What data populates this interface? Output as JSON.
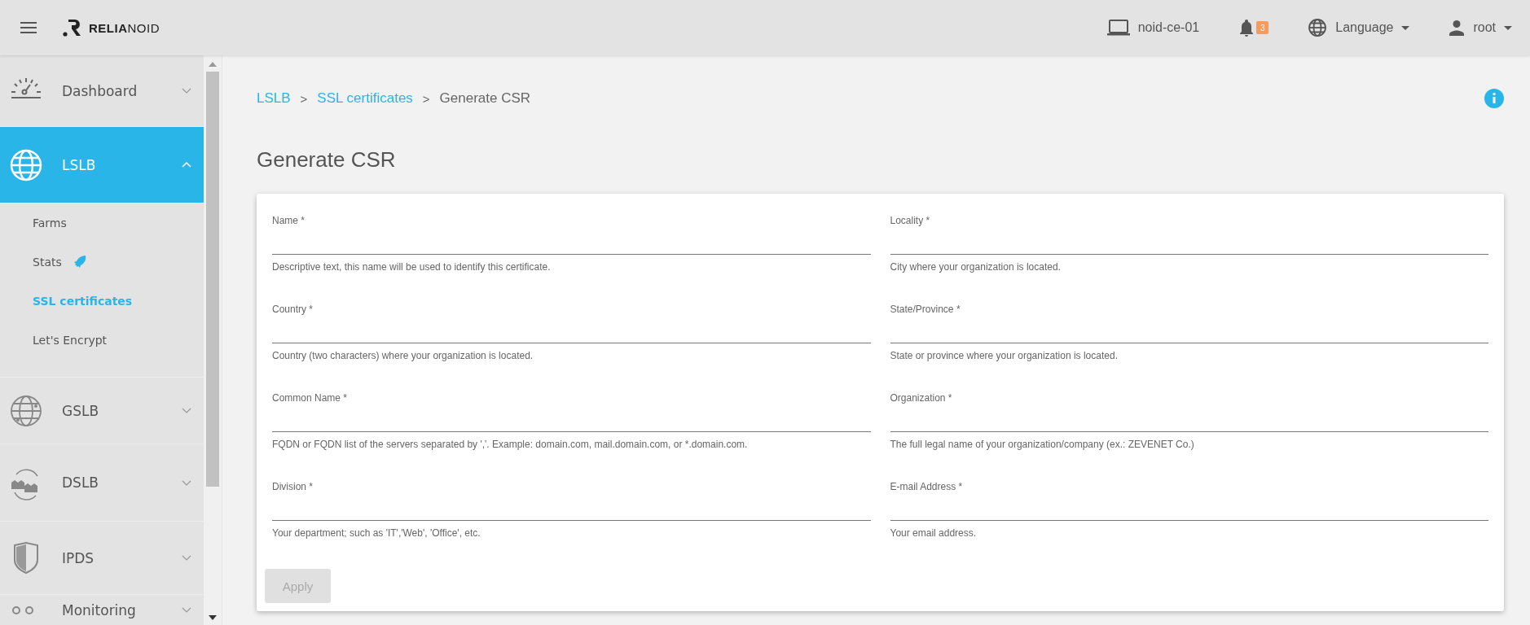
{
  "header": {
    "brand": "**RELIA**NOID",
    "host": "noid-ce-01",
    "notifications": "3",
    "language": "Language",
    "user": "root"
  },
  "sidebar": {
    "items": [
      {
        "label": "Dashboard",
        "kind": "dashboard",
        "selected": false,
        "expanded": false
      },
      {
        "label": "LSLB",
        "kind": "lslb",
        "selected": true,
        "expanded": true,
        "children": [
          {
            "label": "Farms",
            "kind": "plain",
            "selected": false
          },
          {
            "label": "Stats",
            "kind": "featured",
            "selected": false
          },
          {
            "label": "SSL certificates",
            "kind": "plain",
            "selected": true
          },
          {
            "label": "Let's Encrypt",
            "kind": "plain",
            "selected": false
          }
        ]
      },
      {
        "label": "GSLB",
        "kind": "gslb",
        "selected": false,
        "expanded": false
      },
      {
        "label": "DSLB",
        "kind": "dslb",
        "selected": false,
        "expanded": false
      },
      {
        "label": "IPDS",
        "kind": "ipds",
        "selected": false,
        "expanded": false
      },
      {
        "label": "Monitoring",
        "kind": "monitoring",
        "selected": false,
        "expanded": false
      }
    ]
  },
  "breadcrumb": [
    {
      "text": "LSLB",
      "kind": "link"
    },
    {
      "text": ">",
      "kind": "separator"
    },
    {
      "text": "SSL certificates",
      "kind": "link"
    },
    {
      "text": ">",
      "kind": "separator"
    },
    {
      "text": "Generate CSR",
      "kind": "current"
    }
  ],
  "title": "Generate CSR",
  "form": {
    "fields": [
      {
        "label": "Name *",
        "help": "Descriptive text, this name will be used to identify this certificate."
      },
      {
        "label": "Locality *",
        "help": "City where your organization is located."
      },
      {
        "label": "Country *",
        "help": "Country (two characters) where your organization is located."
      },
      {
        "label": "State/Province *",
        "help": "State or province where your organization is located."
      },
      {
        "label": "Common Name *",
        "help": "FQDN or FQDN list of the servers separated by ','. Example: domain.com, mail.domain.com, or *.domain.com."
      },
      {
        "label": "Organization *",
        "help": "The full legal name of your organization/company (ex.: ZEVENET Co.)"
      },
      {
        "label": "Division *",
        "help": "Your department; such as 'IT','Web', 'Office', etc."
      },
      {
        "label": "E-mail Address *",
        "help": "Your email address."
      }
    ],
    "submit": {
      "label": "Apply",
      "disabled": true
    }
  }
}
